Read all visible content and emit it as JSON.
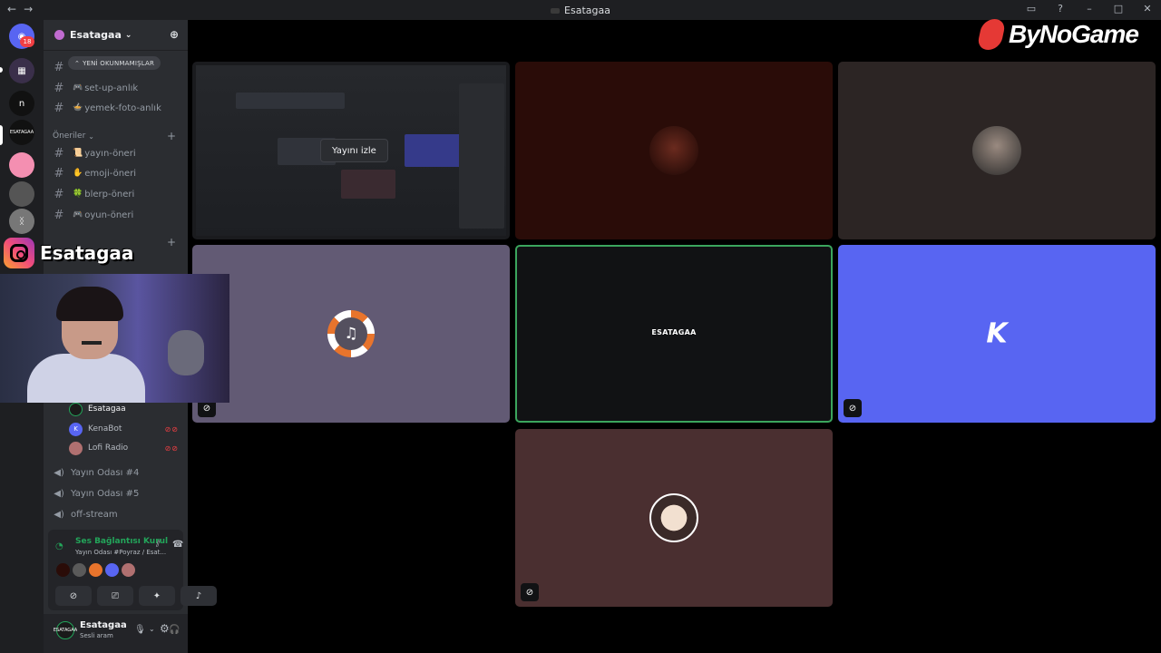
{
  "window": {
    "title": "Esatagaa",
    "back": "←",
    "forward": "→"
  },
  "rail": {
    "badge": "18",
    "server_letter": "n",
    "esatagaa_label": "ESATAGAA"
  },
  "server": {
    "name": "Esatagaa"
  },
  "unread_pill": "YENİ OKUNMAMIŞLAR",
  "channels_top": [
    {
      "emoji": "🎮",
      "label": "set-up-anlık"
    },
    {
      "emoji": "🍲",
      "label": "yemek-foto-anlık"
    }
  ],
  "category_oneriler": "Öneriler",
  "channels_oneri": [
    {
      "emoji": "📜",
      "label": "yayın-öneri"
    },
    {
      "emoji": "✋",
      "label": "emoji-öneri"
    },
    {
      "emoji": "🍀",
      "label": "blerp-öneri"
    },
    {
      "emoji": "🎮",
      "label": "oyun-öneri"
    }
  ],
  "voice_users": [
    {
      "name": "Esatagaa",
      "avatar_color": "#1a1a1a",
      "avatar_text": "",
      "active": true
    },
    {
      "name": "KenaBot",
      "avatar_color": "#5865f2",
      "avatar_text": "K",
      "active": false
    },
    {
      "name": "Lofi Radio",
      "avatar_color": "#a55",
      "avatar_text": "",
      "active": false
    }
  ],
  "voice_channels": [
    {
      "label": "Yayın Odası #4"
    },
    {
      "label": "Yayın Odası #5"
    },
    {
      "label": "off-stream"
    }
  ],
  "voice_panel": {
    "status": "Ses Bağlantısı Kuruldu",
    "room": "Yayın Odası #Poyraz / Esat..."
  },
  "user": {
    "name": "Esatagaa",
    "status": "Sesli aram",
    "avatar_text": "ESATAGAA"
  },
  "overlay": {
    "instagram_handle": "Esatagaa",
    "brand": "ByNoGame"
  },
  "stage": {
    "watch_stream": "Yayını izle",
    "tile_esatagaa_label": "ESATAGAA",
    "kena_glyph": "K"
  },
  "colors": {
    "accent_green": "#23a55a",
    "kena_blue": "#5865f2",
    "lofi_purple": "#625a74",
    "dark_red": "#2a0c08",
    "mauve": "#4a2f30"
  }
}
